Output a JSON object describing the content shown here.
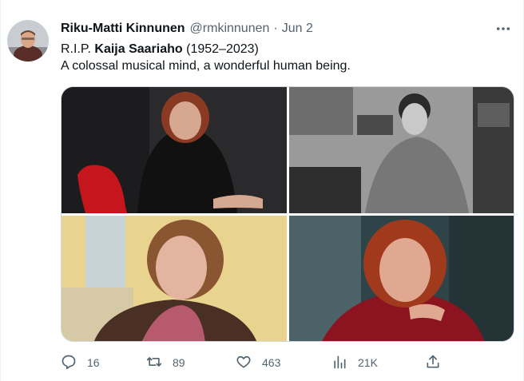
{
  "author": {
    "name": "Riku-Matti Kinnunen",
    "handle": "@rmkinnunen",
    "separator": "·",
    "date": "Jun 2"
  },
  "tweet": {
    "prefix": "R.I.P. ",
    "bold_name": "Kaija Saariaho",
    "years": " (1952–2023)",
    "line2": "A colossal musical mind, a wonderful human being."
  },
  "media": [
    {
      "icon": "photo",
      "tone": "dark-studio"
    },
    {
      "icon": "photo",
      "tone": "black-and-white"
    },
    {
      "icon": "photo",
      "tone": "warm-yellow"
    },
    {
      "icon": "photo",
      "tone": "dark-teal"
    }
  ],
  "actions": {
    "replies": "16",
    "retweets": "89",
    "likes": "463",
    "views": "21K"
  },
  "colors": {
    "text": "#0f1419",
    "secondary": "#536471",
    "border": "#cfd9de"
  }
}
